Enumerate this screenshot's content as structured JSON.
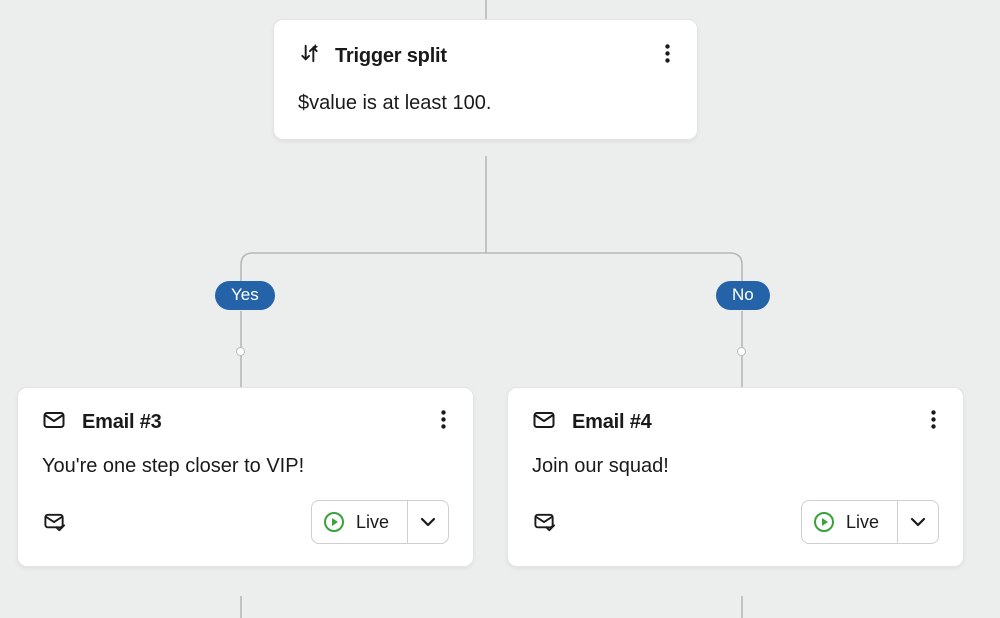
{
  "trigger": {
    "title": "Trigger split",
    "description": "$value is at least 100."
  },
  "branches": {
    "yes_label": "Yes",
    "no_label": "No"
  },
  "emails": {
    "left": {
      "title": "Email #3",
      "preview": "You're one step closer to VIP!",
      "status_label": "Live"
    },
    "right": {
      "title": "Email #4",
      "preview": "Join our squad!",
      "status_label": "Live"
    }
  }
}
